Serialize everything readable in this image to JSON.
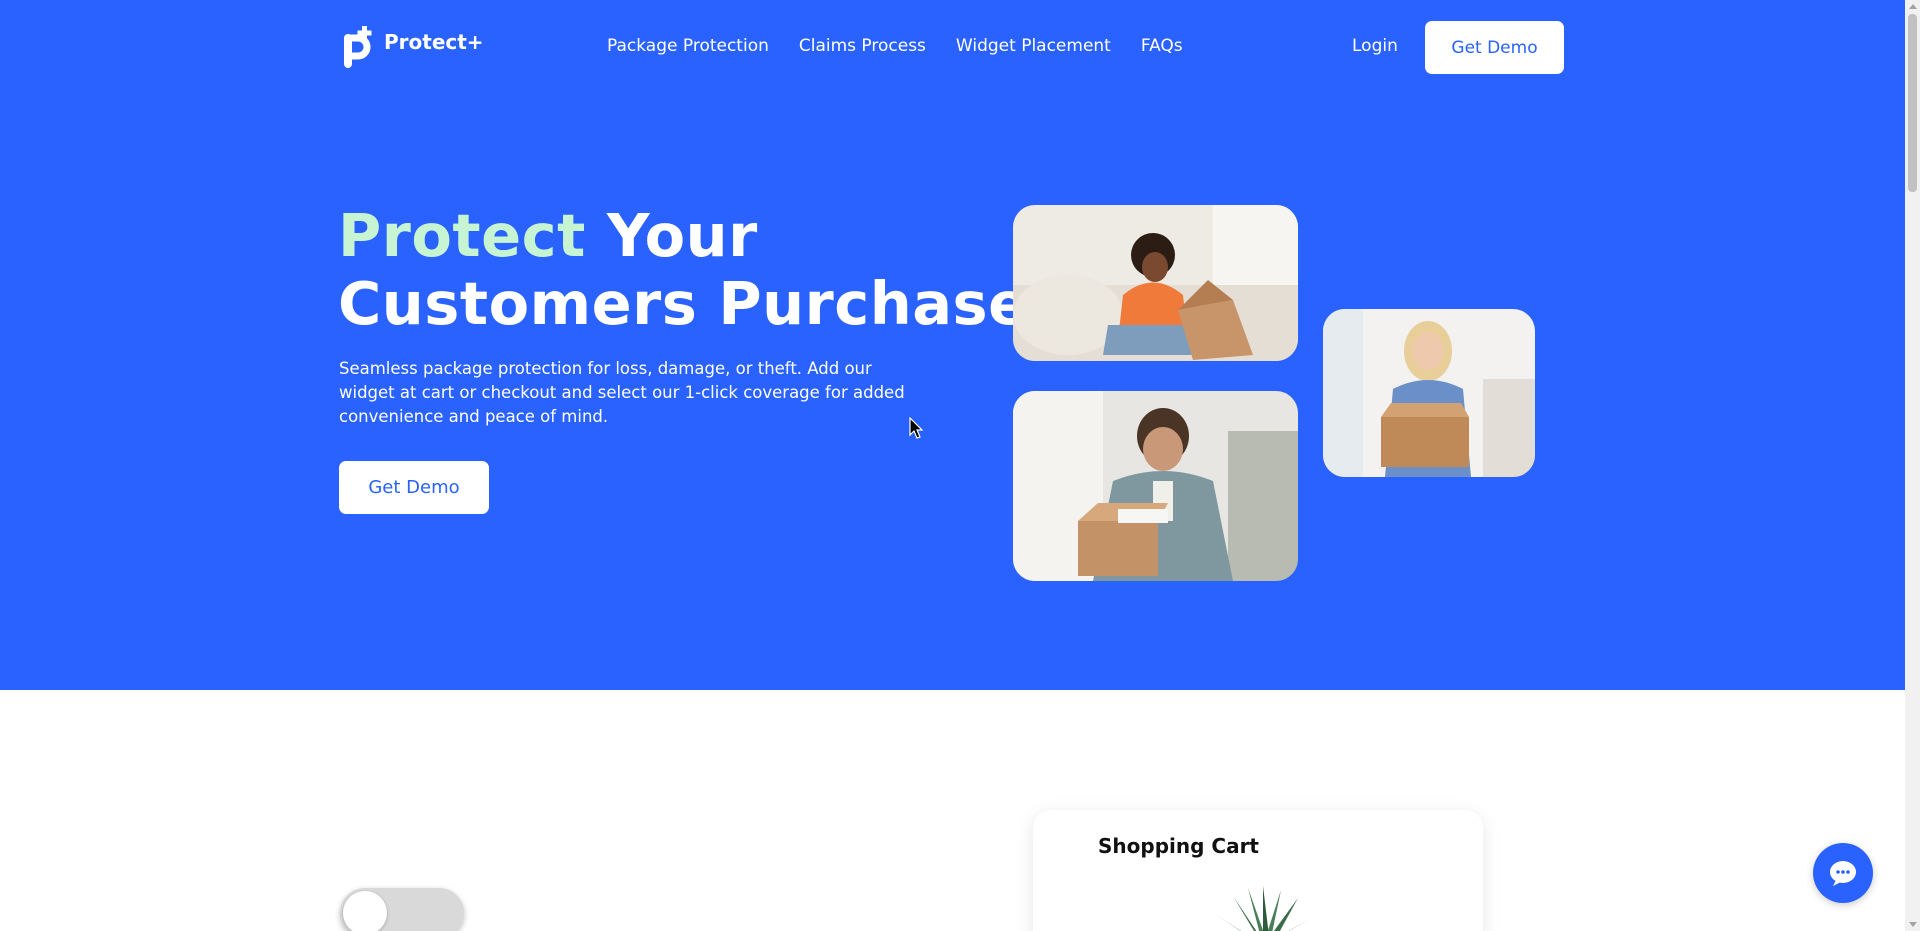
{
  "brand": {
    "name": "Protect+",
    "primary_color": "#2962ff",
    "accent_color": "#c7f5d3",
    "logo_icon": "protect-plus-logo"
  },
  "nav": {
    "links": [
      "Package Protection",
      "Claims Process",
      "Widget Placement",
      "FAQs"
    ],
    "login_label": "Login",
    "demo_label": "Get Demo"
  },
  "hero": {
    "title_accent": "Protect",
    "title_rest_line1": " Your",
    "title_line2": "Customers Purchase.",
    "description": "Seamless package protection for loss, damage, or theft. Add our widget at cart or checkout and select our 1-click coverage for added convenience and peace of mind.",
    "cta_label": "Get Demo",
    "photos": [
      "woman-opening-box-photo",
      "man-opening-box-photo",
      "blonde-woman-with-box-photo"
    ]
  },
  "section2": {
    "toggle_state": "off",
    "cart_title": "Shopping Cart",
    "cart_item_icon": "succulent-plant"
  },
  "widgets": {
    "chat_icon": "chat-bubble-icon"
  }
}
